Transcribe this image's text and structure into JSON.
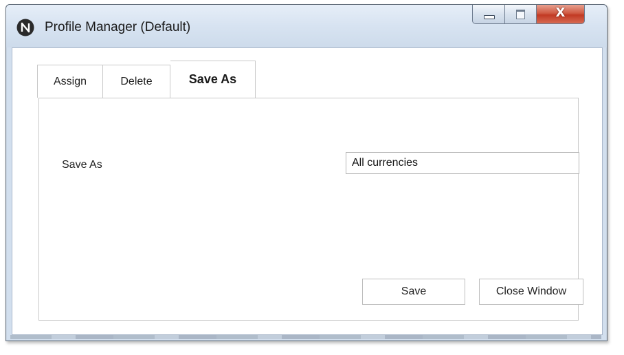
{
  "window": {
    "title": "Profile Manager (Default)",
    "controls": {
      "close_symbol": "X"
    }
  },
  "tabs": [
    {
      "label": "Assign",
      "active": false
    },
    {
      "label": "Delete",
      "active": false
    },
    {
      "label": "Save As",
      "active": true
    }
  ],
  "save_as_panel": {
    "field_label": "Save As",
    "field_value": "All currencies",
    "save_button": "Save",
    "close_button": "Close Window"
  },
  "icons": {
    "app": "app-logo-icon",
    "minimize": "minimize-icon",
    "maximize": "maximize-icon",
    "close": "close-icon"
  },
  "colors": {
    "titlebar": "#d7e3f1",
    "close_button": "#c23a24",
    "tab_border": "#c8c8c8"
  }
}
